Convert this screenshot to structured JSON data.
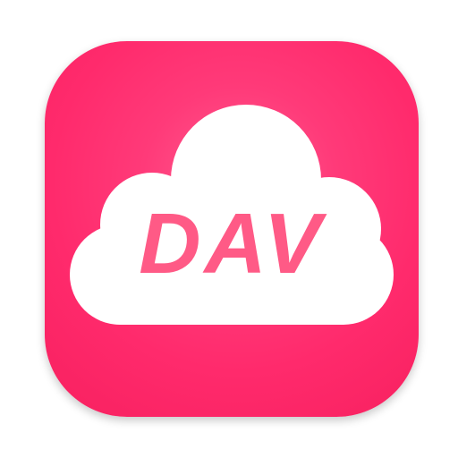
{
  "icon": {
    "label": "DAV",
    "colors": {
      "background_primary": "#ff2a6c",
      "background_highlight": "#ff5c8f",
      "cloud": "#ffffff",
      "text": "#ff5a86"
    },
    "icons": [
      "cloud-icon"
    ]
  }
}
